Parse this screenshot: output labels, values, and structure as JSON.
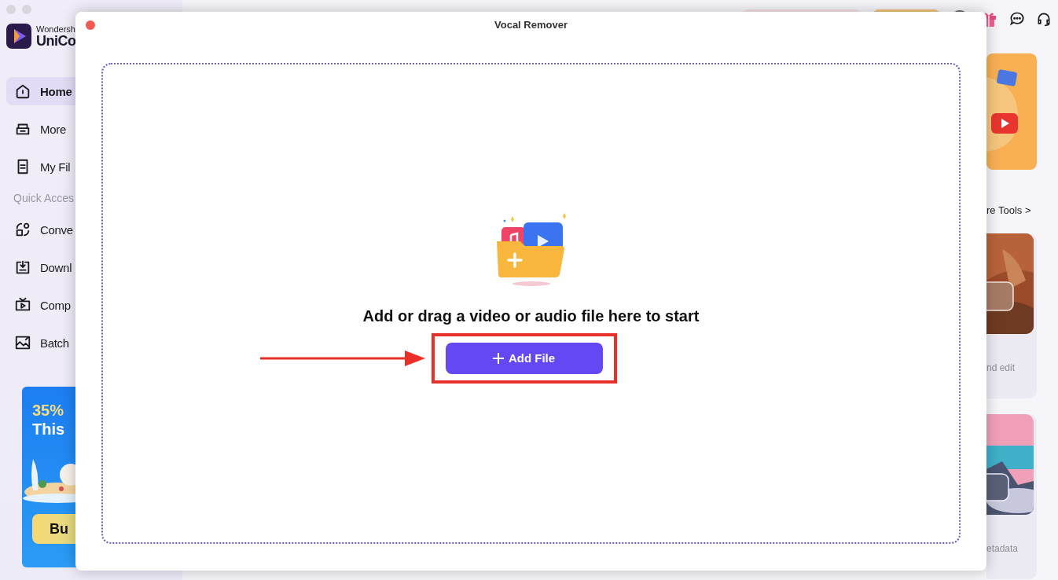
{
  "app": {
    "brand_small": "Wondersh",
    "brand_name": "UniCo"
  },
  "sidebar": {
    "items": [
      {
        "label": "Home",
        "selected": true
      },
      {
        "label": "More ",
        "selected": false
      },
      {
        "label": "My Fil",
        "selected": false
      }
    ],
    "section_label": "Quick Acces",
    "quick_items": [
      {
        "label": "Conve",
        "selected": false
      },
      {
        "label": "Downl",
        "selected": false
      },
      {
        "label": "Comp",
        "selected": false
      },
      {
        "label": "Batch",
        "selected": false
      }
    ]
  },
  "promo": {
    "headline": "35%",
    "subline": "This",
    "button": "Bu"
  },
  "right_panel": {
    "more_tools": "re Tools >",
    "cards": [
      {
        "caption": "nd edit"
      },
      {
        "caption": "etadata"
      }
    ]
  },
  "dialog": {
    "title": "Vocal Remover",
    "prompt": "Add or drag a video or audio file here to start",
    "button": "Add File"
  }
}
